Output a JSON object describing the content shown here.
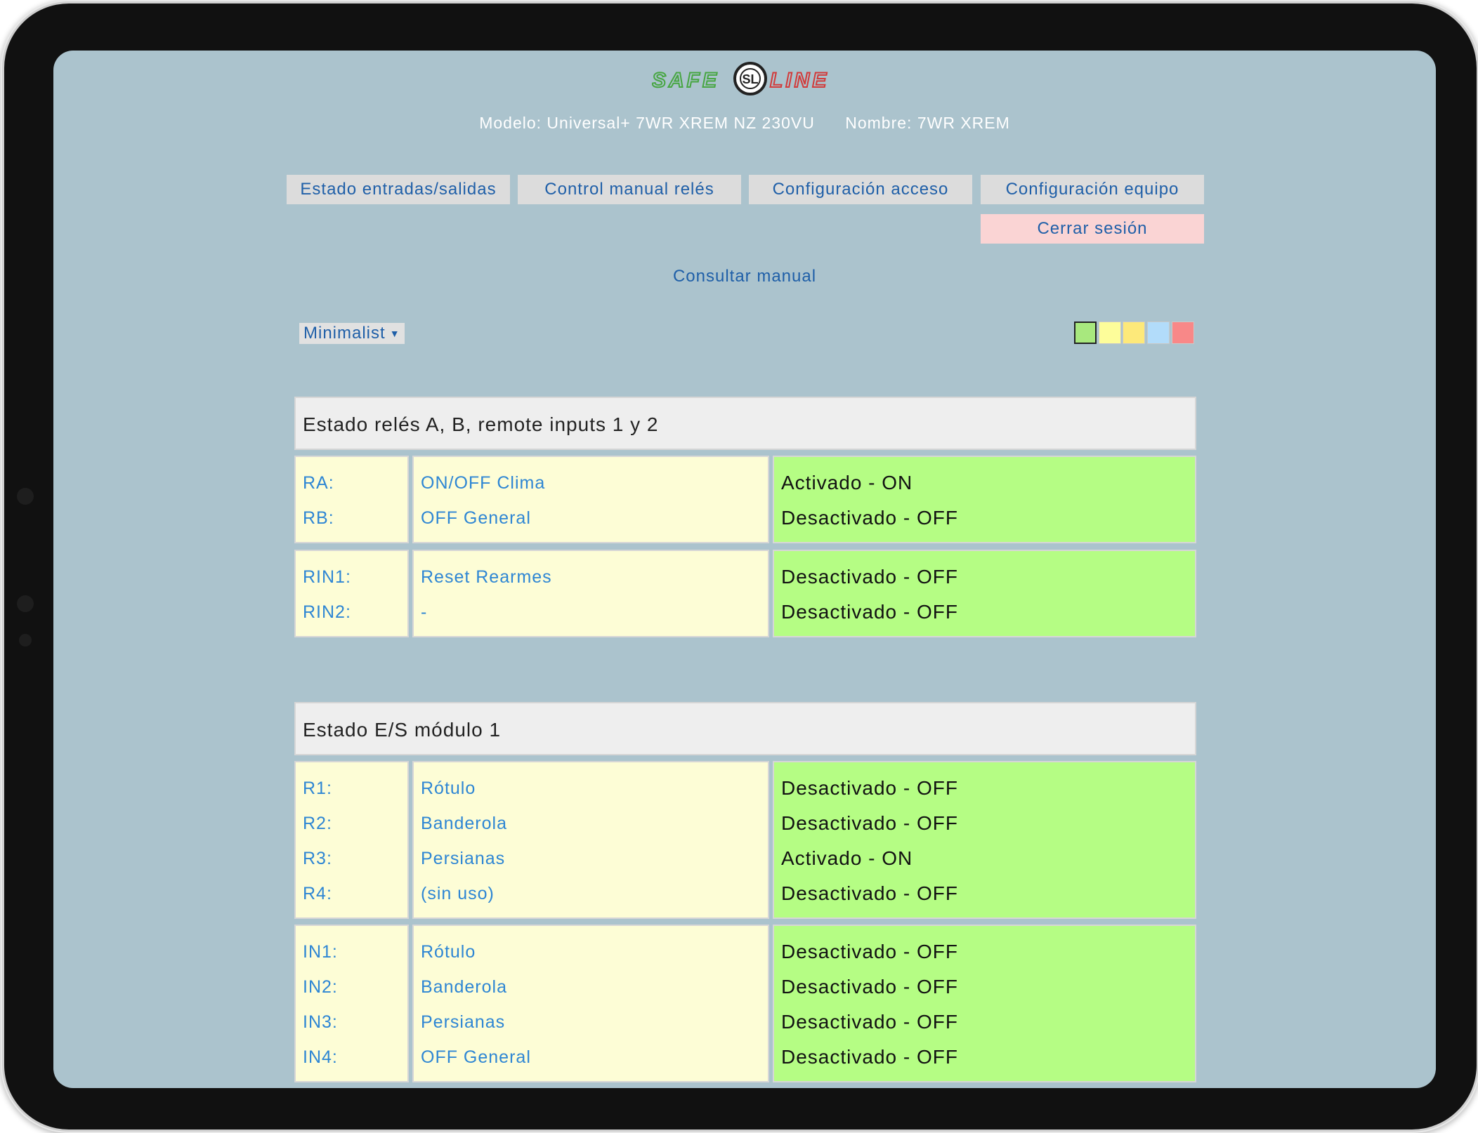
{
  "header": {
    "model": "Modelo: Universal+ 7WR XREM NZ 230VU",
    "name": "Nombre: 7WR XREM",
    "logo_left": "SAFE",
    "logo_center": "SL",
    "logo_right": "LINE"
  },
  "nav": {
    "buttons": [
      "Estado entradas/salidas",
      "Control manual relés",
      "Configuración acceso",
      "Configuración equipo"
    ],
    "logout": "Cerrar sesión"
  },
  "manual_link": "Consultar manual",
  "theme": {
    "selected": "Minimalist"
  },
  "colors": {
    "background": "#abc3cd",
    "swatches": [
      "#a8e87e",
      "#fdfd9a",
      "#fde97a",
      "#b2dcfa",
      "#f88888"
    ],
    "state_bg": "#b5fd84",
    "name_bg": "#fdfdd6"
  },
  "sections": [
    {
      "title": "Estado relés A, B, remote inputs 1 y 2",
      "groups": [
        {
          "labels": [
            "RA:",
            "RB:"
          ],
          "names": [
            "ON/OFF Clima",
            "OFF General"
          ],
          "states": [
            "Activado - ON",
            "Desactivado - OFF"
          ]
        },
        {
          "labels": [
            "RIN1:",
            "RIN2:"
          ],
          "names": [
            "Reset Rearmes",
            "-"
          ],
          "states": [
            "Desactivado - OFF",
            "Desactivado - OFF"
          ]
        }
      ]
    },
    {
      "title": "Estado E/S módulo 1",
      "groups": [
        {
          "labels": [
            "R1:",
            "R2:",
            "R3:",
            "R4:"
          ],
          "names": [
            "Rótulo",
            "Banderola",
            "Persianas",
            "(sin uso)"
          ],
          "states": [
            "Desactivado - OFF",
            "Desactivado - OFF",
            "Activado - ON",
            "Desactivado - OFF"
          ]
        },
        {
          "labels": [
            "IN1:",
            "IN2:",
            "IN3:",
            "IN4:"
          ],
          "names": [
            "Rótulo",
            "Banderola",
            "Persianas",
            "OFF General"
          ],
          "states": [
            "Desactivado - OFF",
            "Desactivado - OFF",
            "Desactivado - OFF",
            "Desactivado - OFF"
          ]
        }
      ]
    }
  ]
}
